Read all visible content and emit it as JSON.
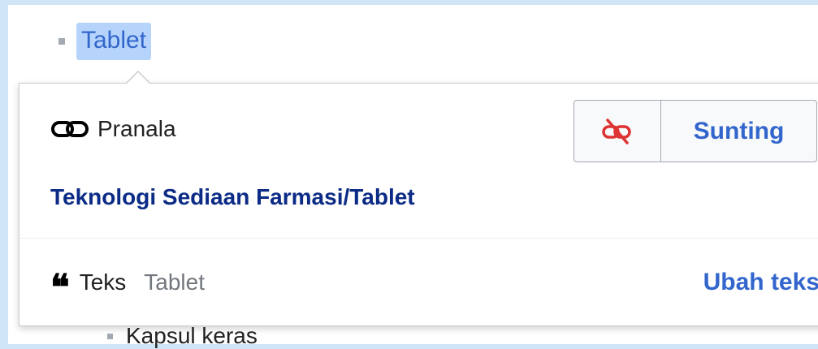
{
  "list": {
    "top_item": "Tablet",
    "bottom_item": "Kapsul keras"
  },
  "popup": {
    "link_label": "Pranala",
    "unlink_icon": "unlink-icon",
    "edit_button": "Sunting",
    "target_page": "Teknologi Sediaan Farmasi/Tablet",
    "text_label": "Teks",
    "text_value": "Tablet",
    "change_text_button": "Ubah teks"
  },
  "colors": {
    "link_blue": "#3366cc",
    "destructive_red": "#d33",
    "highlight": "#b6d4fb"
  }
}
